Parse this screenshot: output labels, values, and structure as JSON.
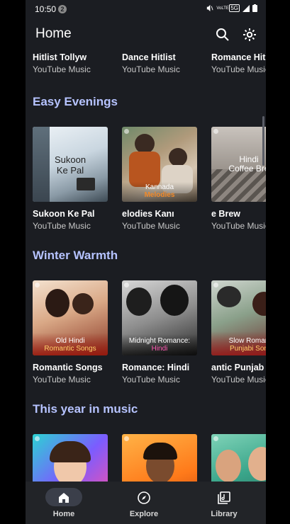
{
  "status": {
    "time": "10:50",
    "notification_count": "2",
    "network": "VoLTE",
    "network_type": "5G"
  },
  "header": {
    "title": "Home"
  },
  "top_row": {
    "items": [
      {
        "title": "Hitlist   Tollyw",
        "subtitle": "YouTube Music"
      },
      {
        "title": "Dance Hitlist",
        "subtitle": "YouTube Music"
      },
      {
        "title": "Romance Hitl",
        "subtitle": "YouTube Music"
      }
    ]
  },
  "sections": [
    {
      "title": "Easy Evenings",
      "items": [
        {
          "title": "Sukoon Ke Pal",
          "subtitle": "YouTube Music",
          "art_line1": "Sukoon",
          "art_line2": "Ke Pal"
        },
        {
          "title": "elodies   Kanı",
          "subtitle": "YouTube Music",
          "art_line1": "Kannada",
          "art_line2": "Melodies"
        },
        {
          "title": "e Brew",
          "subtitle": "YouTube Music",
          "art_line1": "Hindi",
          "art_line2": "Coffee Bre"
        }
      ]
    },
    {
      "title": "Winter Warmth",
      "items": [
        {
          "title": "Romantic Songs",
          "subtitle": "YouTube Music",
          "art_line1": "Old Hindi",
          "art_line2": "Romantic Songs"
        },
        {
          "title": "Romance: Hindi",
          "subtitle": "YouTube Music",
          "art_line1": "Midnight Romance:",
          "art_line2": "Hindi"
        },
        {
          "title": "antic Punjab",
          "subtitle": "YouTube Music",
          "art_line1": "Slow Roman",
          "art_line2": "Punjabi Son"
        }
      ]
    },
    {
      "title": "This year in music"
    }
  ],
  "nav": [
    {
      "label": "Home",
      "icon": "home-icon",
      "active": true
    },
    {
      "label": "Explore",
      "icon": "explore-icon",
      "active": false
    },
    {
      "label": "Library",
      "icon": "library-icon",
      "active": false
    }
  ],
  "colors": {
    "accent": "#b6c3ff",
    "background": "#1b1d22",
    "navbar": "#222428"
  }
}
